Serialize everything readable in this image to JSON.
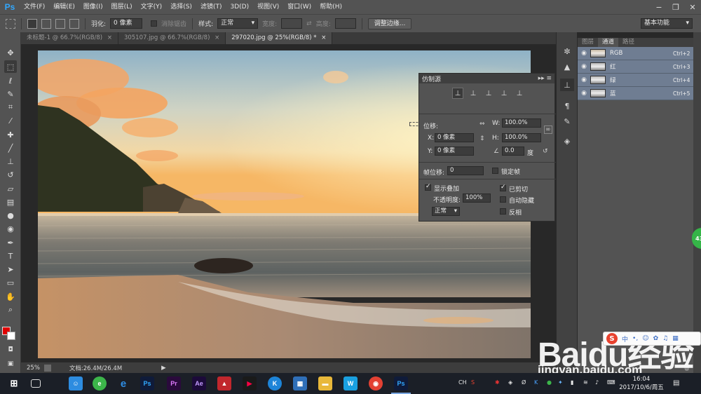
{
  "menubar": {
    "logo": "Ps",
    "items": [
      "文件(F)",
      "编辑(E)",
      "图像(I)",
      "图层(L)",
      "文字(Y)",
      "选择(S)",
      "滤镜(T)",
      "3D(D)",
      "视图(V)",
      "窗口(W)",
      "帮助(H)"
    ],
    "min": "−",
    "restore": "❐",
    "close": "✕"
  },
  "options": {
    "feather_label": "羽化:",
    "feather_value": "0 像素",
    "antialias_label": "消除锯齿",
    "style_label": "样式:",
    "style_value": "正常",
    "width_label": "宽度:",
    "height_label": "高度:",
    "refine_edge": "调整边缘...",
    "workspace": "基本功能"
  },
  "tabs": [
    {
      "label": "未标题-1 @ 66.7%(RGB/8)",
      "close": "×"
    },
    {
      "label": "305107.jpg @ 66.7%(RGB/8)",
      "close": "×"
    },
    {
      "label": "297020.jpg @ 25%(RGB/8) *",
      "close": "×"
    }
  ],
  "status": {
    "zoom": "25%",
    "doc": "文档:26.4M/26.4M"
  },
  "clone_source": {
    "title": "仿制源",
    "offset_label": "位移:",
    "w_label": "W:",
    "w_value": "100.0%",
    "h_label": "H:",
    "h_value": "100.0%",
    "x_label": "X:",
    "x_value": "0 像素",
    "y_label": "Y:",
    "y_value": "0 像素",
    "angle_value": "0.0",
    "angle_unit": "度",
    "frame_label": "帧位移:",
    "frame_value": "0",
    "lock_frame": "锁定帧",
    "show_overlay": "显示叠加",
    "opacity_label": "不透明度:",
    "opacity_value": "100%",
    "clipped": "已剪切",
    "auto_hide": "自动隐藏",
    "blend_mode": "正常",
    "invert": "反相"
  },
  "layers_panel": {
    "tabs": [
      "图层",
      "通道",
      "路径"
    ],
    "channels": [
      {
        "name": "RGB",
        "shortcut": "Ctrl+2"
      },
      {
        "name": "红",
        "shortcut": "Ctrl+3"
      },
      {
        "name": "绿",
        "shortcut": "Ctrl+4"
      },
      {
        "name": "蓝",
        "shortcut": "Ctrl+5"
      }
    ]
  },
  "taskbar": {
    "apps": [
      {
        "name": "Ps",
        "color": "#0f1b3a"
      },
      {
        "name": "Pr",
        "color": "#2a0a3c"
      },
      {
        "name": "Ae",
        "color": "#1c0a3a"
      },
      {
        "name": "Ps",
        "color": "#0f1b3a"
      }
    ],
    "ime": "CH",
    "time": "16:04",
    "date": "2017/10/6/周五"
  },
  "badge": "43",
  "watermark": {
    "logo": "Baidu经验",
    "url": "jingyan.baidu.com"
  },
  "colors": {
    "accent_channel": "#6f7d92",
    "ps_blue": "#31a8ff",
    "foreground": "#e00000",
    "background": "#ffffff"
  }
}
